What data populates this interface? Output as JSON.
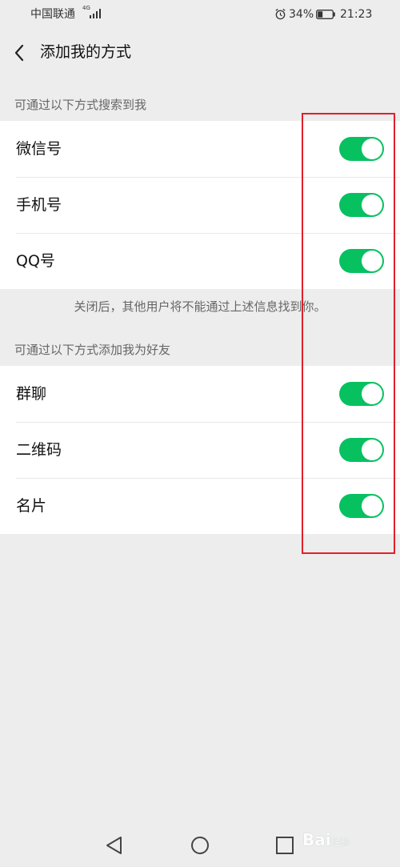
{
  "status_bar": {
    "carrier": "中国联通",
    "network": "4G",
    "battery": "34%",
    "battery_level": 0.34,
    "time": "21:23",
    "icons": [
      "signal-icon",
      "alarm-icon",
      "battery-icon"
    ]
  },
  "header": {
    "title": "添加我的方式",
    "back_icon": "chevron-left-icon"
  },
  "search_section": {
    "label": "可通过以下方式搜索到我",
    "items": [
      {
        "label": "微信号",
        "enabled": true
      },
      {
        "label": "手机号",
        "enabled": true
      },
      {
        "label": "QQ号",
        "enabled": true
      }
    ],
    "note": "关闭后，其他用户将不能通过上述信息找到你。"
  },
  "add_section": {
    "label": "可通过以下方式添加我为好友",
    "items": [
      {
        "label": "群聊",
        "enabled": true
      },
      {
        "label": "二维码",
        "enabled": true
      },
      {
        "label": "名片",
        "enabled": true
      }
    ]
  },
  "system_nav": {
    "icons": [
      "back-triangle-icon",
      "home-circle-icon",
      "recents-square-icon"
    ]
  },
  "watermark": {
    "text": "Bai",
    "suffix": "经验"
  },
  "colors": {
    "background": "#ededed",
    "toggle_on": "#07c160",
    "highlight": "#e0202a"
  }
}
